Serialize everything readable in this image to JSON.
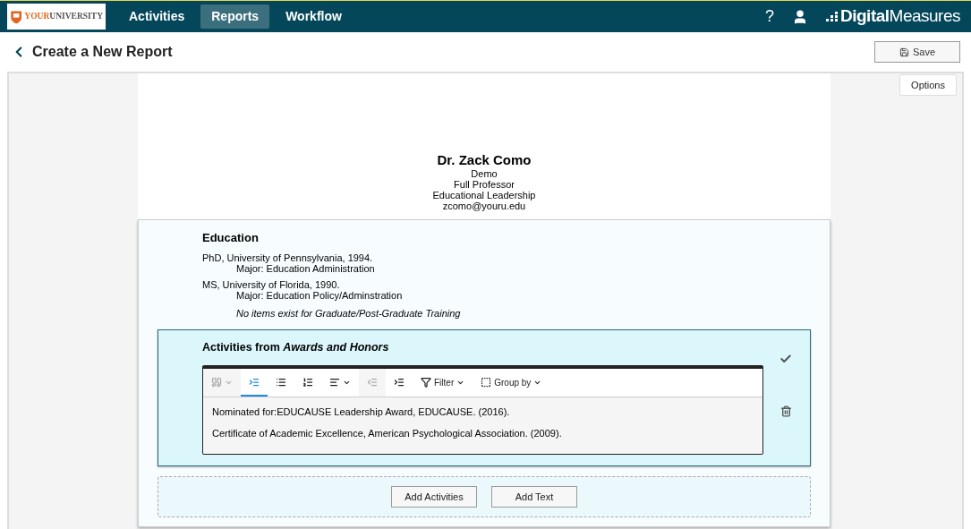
{
  "nav": {
    "logo_primary": "YOUR",
    "logo_secondary": "UNIVERSITY",
    "tabs": [
      {
        "label": "Activities",
        "selected": false
      },
      {
        "label": "Reports",
        "selected": true
      },
      {
        "label": "Workflow",
        "selected": false
      }
    ],
    "help": "?",
    "brand": "**Digital**Measures"
  },
  "header": {
    "title": "Create a New Report",
    "save": "Save"
  },
  "options": "Options",
  "profile": {
    "name": "Dr. Zack Como",
    "lines": [
      "Demo",
      "Full Professor",
      "Educational Leadership",
      "zcomo@youru.edu"
    ]
  },
  "education": {
    "heading": "Education",
    "entries": [
      {
        "degree": "PhD, University of Pennsylvania, 1994.",
        "major": "Major: Education Administration"
      },
      {
        "degree": "MS, University of Florida, 1990.",
        "major": "Major: Education Policy/Adminstration"
      }
    ],
    "note": "No items exist for Graduate/Post-Graduate Training"
  },
  "activities": {
    "heading": "Activities from *Awards and Honors*",
    "toolbar": [
      {
        "kind": "quote",
        "disabled": true,
        "selected": false
      },
      {
        "kind": "hanging",
        "disabled": false,
        "selected": true
      },
      {
        "kind": "bullets",
        "disabled": false,
        "selected": false
      },
      {
        "kind": "numbers",
        "disabled": false,
        "selected": false
      },
      {
        "kind": "align",
        "disabled": false,
        "selected": false
      },
      {
        "kind": "outdent",
        "disabled": true,
        "selected": false
      },
      {
        "kind": "indent",
        "disabled": false,
        "selected": false
      },
      {
        "kind": "filter",
        "label": "Filter",
        "disabled": false,
        "selected": false
      },
      {
        "kind": "group",
        "label": "Group by",
        "disabled": false,
        "selected": false
      }
    ],
    "items": [
      "Nominated for:EDUCAUSE Leadership Award, EDUCAUSE. (2016).",
      "Certificate of Academic Excellence, American Psychological Association. (2009)."
    ]
  },
  "add_buttons": [
    "Add Activities",
    "Add Text"
  ]
}
